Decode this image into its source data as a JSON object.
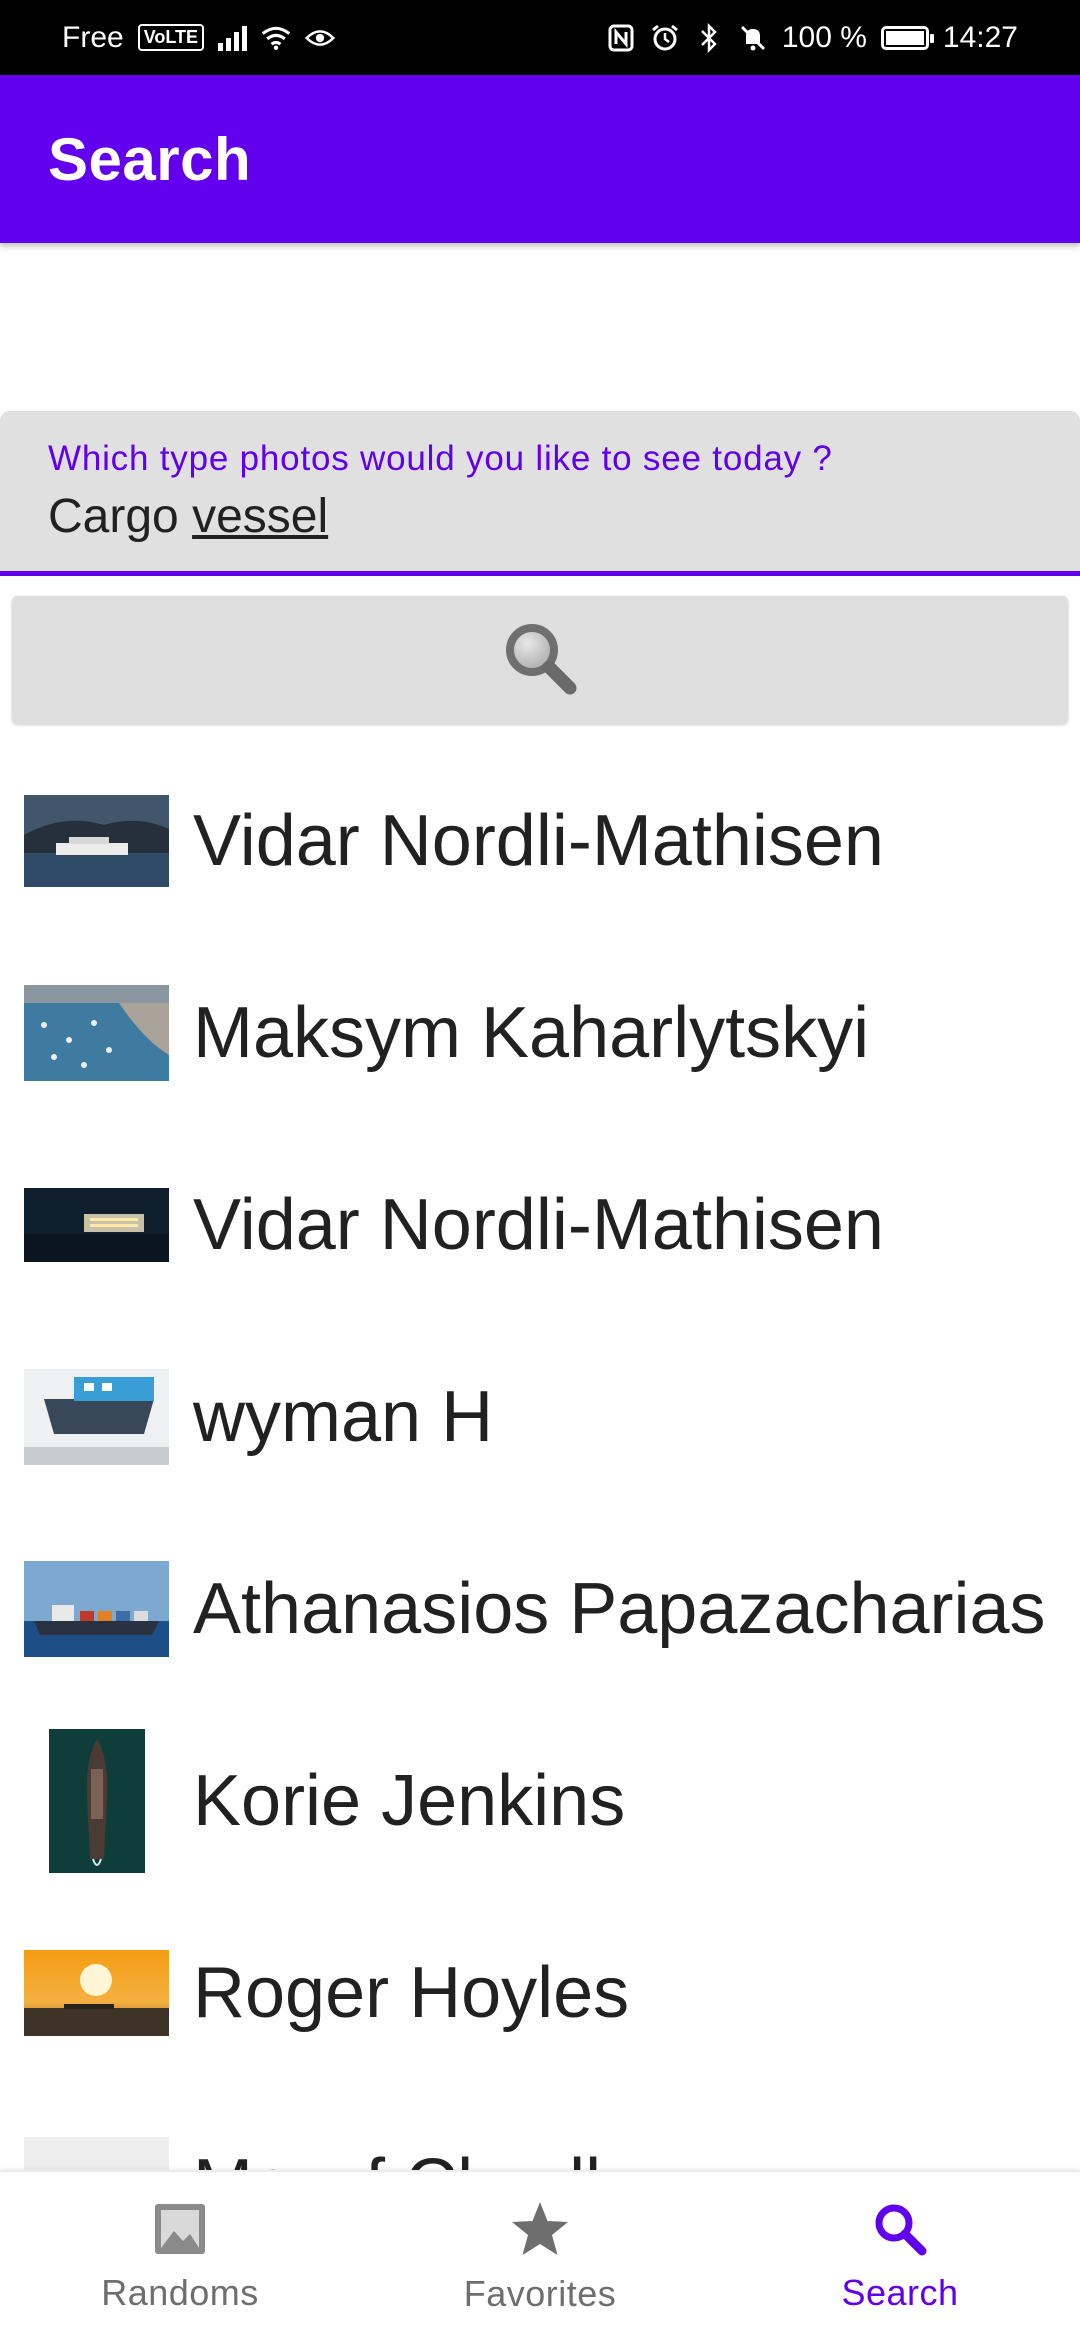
{
  "status_bar": {
    "carrier": "Free",
    "volte": "VoLTE",
    "battery_percent": "100 %",
    "time": "14:27",
    "battery_level": 1.0
  },
  "app_bar": {
    "title": "Search"
  },
  "search_field": {
    "label": "Which type photos would you like to see today ?",
    "value_word1": "Cargo",
    "value_word2": "vessel"
  },
  "search_button": {
    "icon": "magnifier-icon"
  },
  "results": [
    {
      "name": "Vidar Nordli-Mathisen",
      "thumb": "cruise-ship-fjord"
    },
    {
      "name": "Maksym Kaharlytskyi",
      "thumb": "harbor-boats"
    },
    {
      "name": "Vidar Nordli-Mathisen",
      "thumb": "ship-at-night"
    },
    {
      "name": "wyman H",
      "thumb": "blue-cargo-boat"
    },
    {
      "name": "Athanasios Papazacharias",
      "thumb": "cargo-ship-sea"
    },
    {
      "name": "Korie Jenkins",
      "thumb": "aerial-ship"
    },
    {
      "name": "Roger Hoyles",
      "thumb": "sunset-sea"
    },
    {
      "name": "Mo…f Ch…ll",
      "thumb": "placeholder-gray"
    }
  ],
  "bottom_nav": {
    "items": [
      {
        "label": "Randoms",
        "icon": "image-icon"
      },
      {
        "label": "Favorites",
        "icon": "star-icon"
      },
      {
        "label": "Search",
        "icon": "search-icon"
      }
    ],
    "active": "Search"
  },
  "colors": {
    "primary": "#6200ee",
    "field_bg": "#e0e0e0",
    "nav_inactive": "#6e6e6e"
  }
}
